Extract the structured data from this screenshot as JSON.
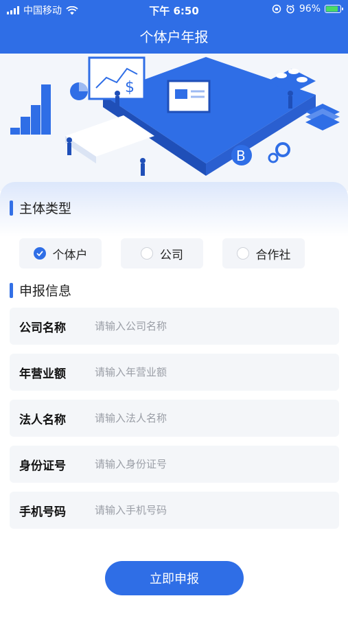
{
  "status": {
    "carrier": "中国移动",
    "time": "下午 6:50",
    "battery": "96%"
  },
  "nav": {
    "title": "个体户年报"
  },
  "subject_type": {
    "title": "主体类型",
    "options": [
      {
        "label": "个体户",
        "selected": true
      },
      {
        "label": "公司",
        "selected": false
      },
      {
        "label": "合作社",
        "selected": false
      }
    ]
  },
  "declare_info": {
    "title": "申报信息",
    "fields": [
      {
        "label": "公司名称",
        "placeholder": "请输入公司名称",
        "value": ""
      },
      {
        "label": "年营业额",
        "placeholder": "请输入年营业额",
        "value": ""
      },
      {
        "label": "法人名称",
        "placeholder": "请输入法人名称",
        "value": ""
      },
      {
        "label": "身份证号",
        "placeholder": "请输入身份证号",
        "value": ""
      },
      {
        "label": "手机号码",
        "placeholder": "请输入手机号码",
        "value": ""
      }
    ]
  },
  "submit_label": "立即申报",
  "colors": {
    "primary": "#2f6ee6",
    "field_bg": "#f4f6f9"
  }
}
